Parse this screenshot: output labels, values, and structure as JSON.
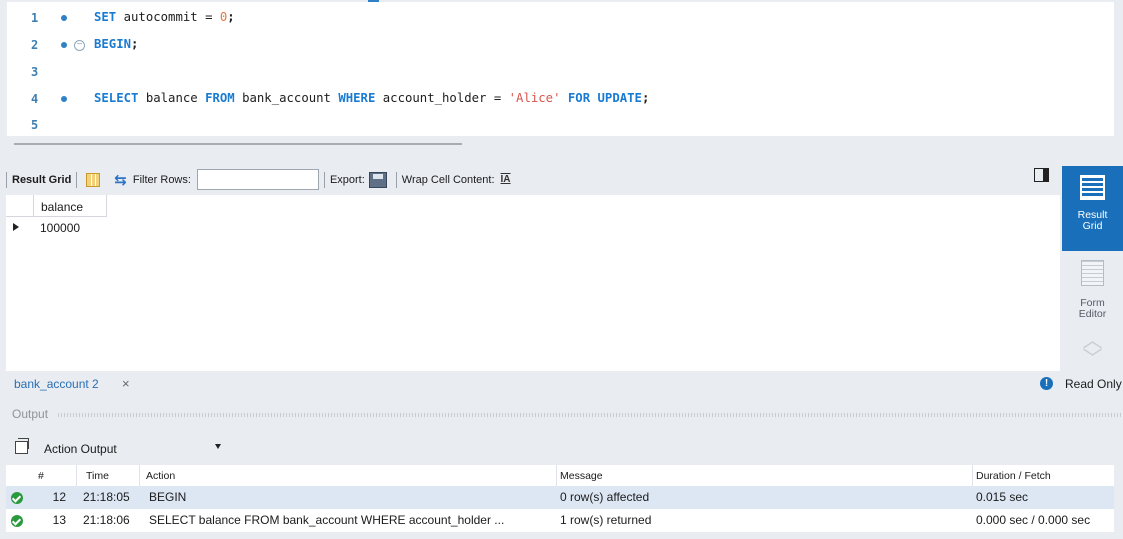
{
  "editor": {
    "lines": [
      {
        "number": "1",
        "text": "SET autocommit = 0;"
      },
      {
        "number": "2",
        "text": "BEGIN;"
      },
      {
        "number": "3",
        "text": ""
      },
      {
        "number": "4",
        "text": "SELECT balance FROM bank_account WHERE account_holder = 'Alice' FOR UPDATE;"
      },
      {
        "number": "5",
        "text": ""
      }
    ]
  },
  "result_toolbar": {
    "result_grid_label": "Result Grid",
    "filter_rows_label": "Filter Rows:",
    "filter_value": "",
    "export_label": "Export:",
    "wrap_label": "Wrap Cell Content:"
  },
  "grid": {
    "columns": [
      "balance"
    ],
    "rows": [
      [
        "100000"
      ]
    ]
  },
  "side_panel": {
    "result_grid": [
      "Result",
      "Grid"
    ],
    "form_editor": [
      "Form",
      "Editor"
    ]
  },
  "tab_bar": {
    "tab_label": "bank_account 2",
    "close_glyph": "×",
    "status": "Read Only"
  },
  "output": {
    "title": "Output",
    "selector": "Action Output",
    "headers": {
      "num": "#",
      "time": "Time",
      "action": "Action",
      "message": "Message",
      "duration": "Duration / Fetch"
    },
    "rows": [
      {
        "num": "12",
        "time": "21:18:05",
        "action": "BEGIN",
        "message": "0 row(s) affected",
        "duration": "0.015 sec",
        "status": "success"
      },
      {
        "num": "13",
        "time": "21:18:06",
        "action": "SELECT balance FROM bank_account WHERE account_holder ...",
        "message": "1 row(s) returned",
        "duration": "0.000 sec / 0.000 sec",
        "status": "success"
      }
    ]
  },
  "colors": {
    "accent": "#1a6fba",
    "keyword": "#1a7bd3",
    "number": "#e8763d",
    "string": "#d9564e",
    "success": "#2b9a3f",
    "selected_row": "#dde7f4"
  }
}
